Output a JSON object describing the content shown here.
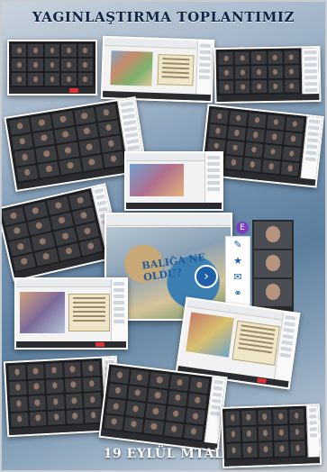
{
  "poster": {
    "title": "YAGINLAŞTIRMA TOPLANTIMIZ",
    "footer": "19 EYLÜL MTAL"
  },
  "center_screen": {
    "artwork_caption": "BALIĞA NE OLDU?",
    "avatar_letter": "E",
    "next_icon": "chevron-right-icon",
    "side_icons": [
      "pencil-icon",
      "star-icon",
      "chat-icon",
      "link-icon"
    ]
  },
  "colors": {
    "title": "#0e2440",
    "footer": "#ffffff",
    "background_mid": "#5c7f9f",
    "accent_blue": "#1f5fa8",
    "accent_purple": "#7a3fc1"
  }
}
